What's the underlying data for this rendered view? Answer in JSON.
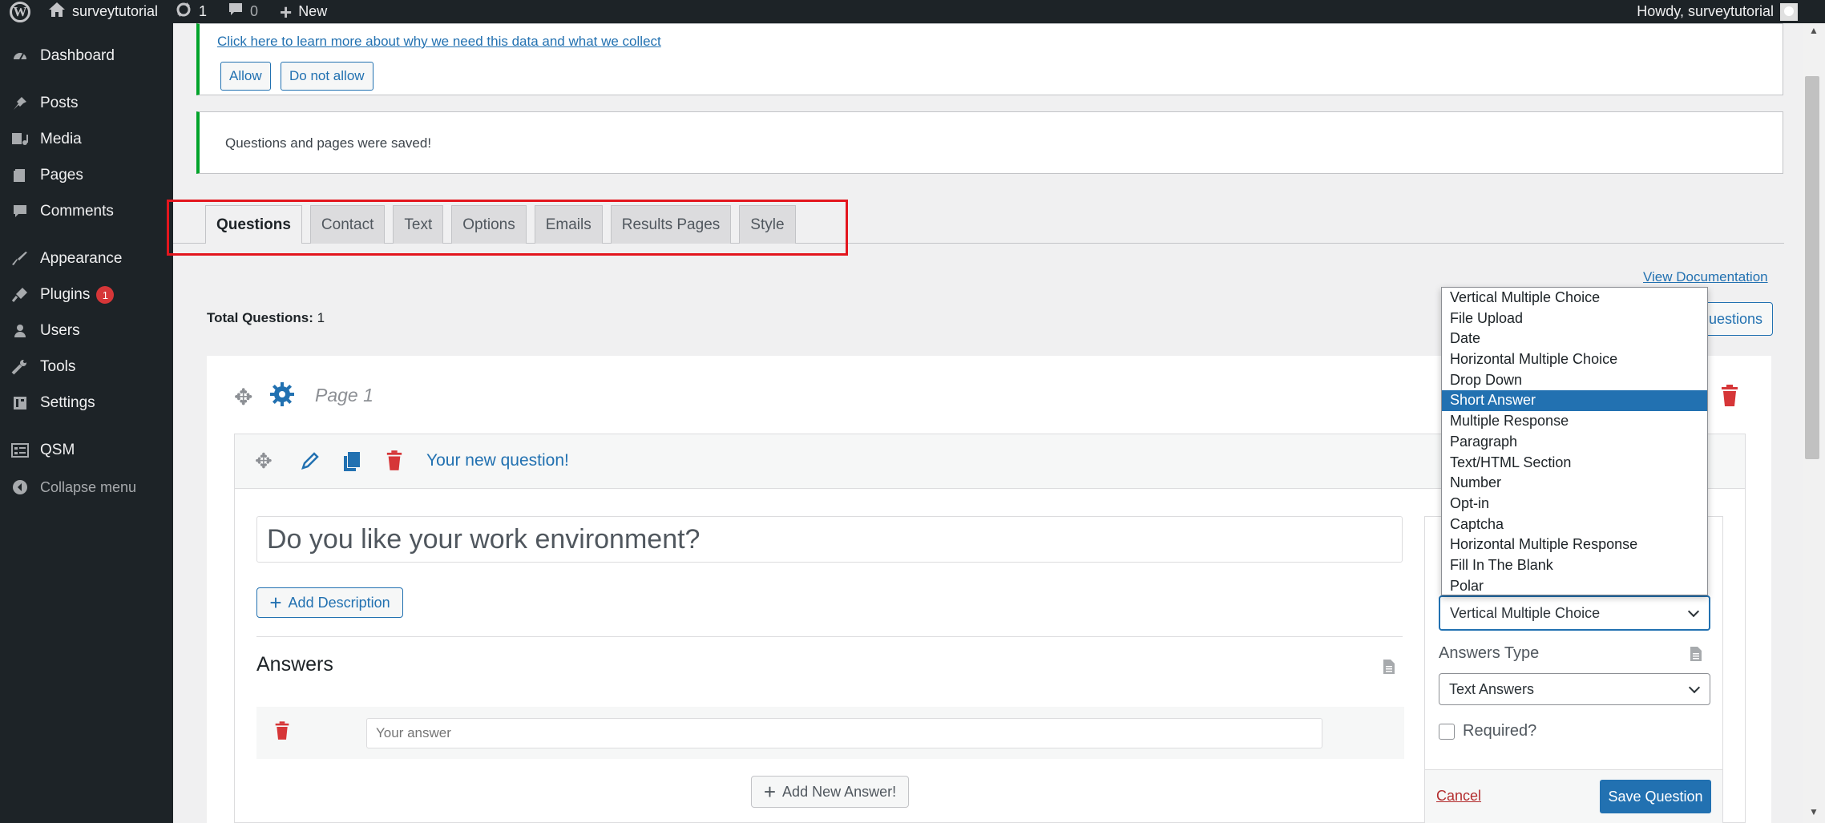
{
  "adminbar": {
    "site_name": "surveytutorial",
    "updates_count": "1",
    "comments_count": "0",
    "new_label": "New",
    "howdy": "Howdy, surveytutorial"
  },
  "sidebar": {
    "items": [
      {
        "label": "Dashboard",
        "icon": "dashboard-icon"
      },
      {
        "label": "Posts",
        "icon": "pin-icon"
      },
      {
        "label": "Media",
        "icon": "media-icon"
      },
      {
        "label": "Pages",
        "icon": "pages-icon"
      },
      {
        "label": "Comments",
        "icon": "comment-icon"
      },
      {
        "label": "Appearance",
        "icon": "brush-icon"
      },
      {
        "label": "Plugins",
        "icon": "plugin-icon",
        "badge": "1"
      },
      {
        "label": "Users",
        "icon": "users-icon"
      },
      {
        "label": "Tools",
        "icon": "wrench-icon"
      },
      {
        "label": "Settings",
        "icon": "settings-icon"
      },
      {
        "label": "QSM",
        "icon": "qsm-icon"
      }
    ],
    "collapse_label": "Collapse menu"
  },
  "notice_data": {
    "link_text": "Click here to learn more about why we need this data and what we collect",
    "allow_label": "Allow",
    "deny_label": "Do not allow"
  },
  "notice_saved": {
    "text": "Questions and pages were saved!"
  },
  "tabs": [
    "Questions",
    "Contact",
    "Text",
    "Options",
    "Emails",
    "Results Pages",
    "Style"
  ],
  "questions_page": {
    "view_docs": "View Documentation",
    "total_label": "Total Questions:",
    "total_value": "1",
    "partial_button": "uestions",
    "page_label": "Page 1"
  },
  "question": {
    "header_title": "Your new question!",
    "title_value": "Do you like your work environment?",
    "add_description": "Add Description",
    "answers_heading": "Answers",
    "answer_placeholder": "Your answer",
    "add_new_answer": "Add New Answer!"
  },
  "settings_panel": {
    "question_type_value": "Vertical Multiple Choice",
    "answers_type_label": "Answers Type",
    "answers_type_value": "Text Answers",
    "required_label": "Required?",
    "cancel_label": "Cancel",
    "save_label": "Save Question"
  },
  "question_type_options": [
    "Vertical Multiple Choice",
    "File Upload",
    "Date",
    "Horizontal Multiple Choice",
    "Drop Down",
    "Short Answer",
    "Multiple Response",
    "Paragraph",
    "Text/HTML Section",
    "Number",
    "Opt-in",
    "Captcha",
    "Horizontal Multiple Response",
    "Fill In The Blank",
    "Polar"
  ],
  "highlighted_option": "Short Answer",
  "colors": {
    "admin_dark": "#1d2327",
    "accent_blue": "#2271b1",
    "delete_red": "#d63638",
    "success_green": "#00a32a",
    "highlight_box": "#e3161e"
  }
}
